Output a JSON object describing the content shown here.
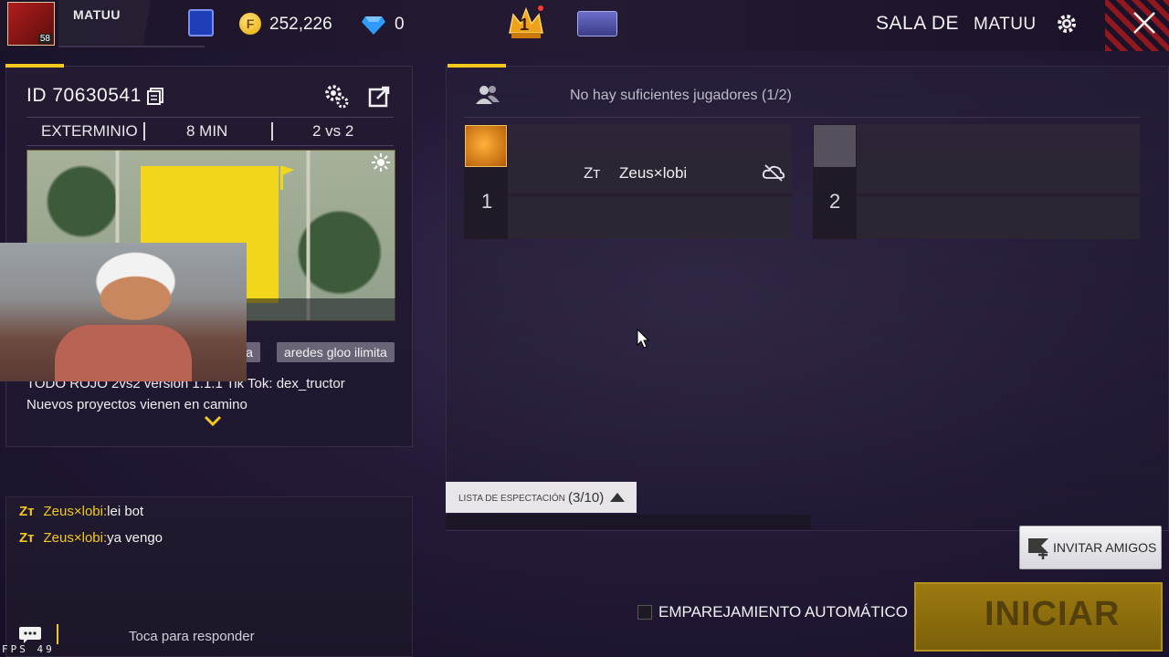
{
  "topbar": {
    "player_name": "MATUU",
    "player_level": "58",
    "gold": "252,226",
    "diamonds": "0",
    "crown_rank": "1",
    "room_title": "SALA DE",
    "room_owner": "MATUU"
  },
  "room": {
    "id_label": "ID",
    "id_value": "70630541",
    "mode": "EXTERMINIO",
    "duration": "8 MIN",
    "format": "2 vs 2",
    "tags": [
      "ia",
      "aredes gloo ilimita"
    ],
    "description_line1": "TODO ROJO 2vs2  versión 1.1.1 Tik Tok: dex_tructor",
    "description_line2": "Nuevos proyectos vienen en camino"
  },
  "chat": {
    "messages": [
      {
        "tag": "Zт",
        "name": "Zeus×lobi:",
        "text": "lei bot"
      },
      {
        "tag": "Zт",
        "name": "Zeus×lobi:",
        "text": "ya vengo"
      }
    ],
    "reply_placeholder": "Toca para responder",
    "fps_label": "FPS",
    "fps_value": "49"
  },
  "lobby": {
    "status": "No hay suficientes jugadores (1/2)",
    "team1_number": "1",
    "team2_number": "2",
    "player_tag": "Zт",
    "player_name": "Zeus×lobi",
    "spectator_label": "LISTA DE ESPECTACIÓN",
    "spectator_count": "(3/10)",
    "invite_label": "INVITAR AMIGOS",
    "auto_match_label": "EMPAREJAMIENTO AUTOMÁTICO",
    "start_label": "INICIAR"
  },
  "colors": {
    "accent": "#f3c91d",
    "background": "#241a38",
    "start_button": "#8c6c0d"
  }
}
